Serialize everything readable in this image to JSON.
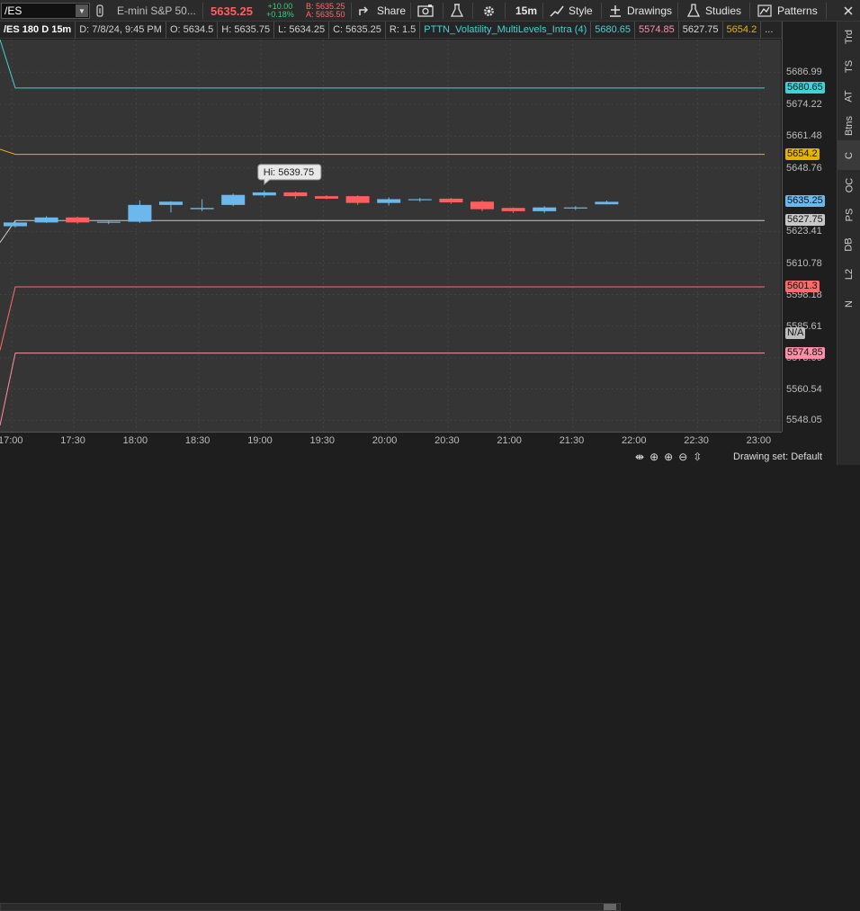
{
  "toolbar": {
    "symbol": "/ES",
    "description": "E-mini S&P 50...",
    "last_price": "5635.25",
    "change": "+10.00",
    "change_pct": "+0.18%",
    "bid": "B: 5635.25",
    "ask": "A: 5635.50",
    "share_label": "Share",
    "timeframe": "15m",
    "style_label": "Style",
    "drawings_label": "Drawings",
    "studies_label": "Studies",
    "patterns_label": "Patterns"
  },
  "infobar": {
    "title": "/ES 180 D 15m",
    "date": "D: 7/8/24, 9:45 PM",
    "open": "O: 5634.5",
    "high": "H: 5635.75",
    "low": "L: 5634.25",
    "close": "C: 5635.25",
    "range": "R: 1.5",
    "study": "PTTN_Volatility_MultiLevels_Intra (4)",
    "levels": [
      "5680.65",
      "5574.85",
      "5627.75",
      "5654.2"
    ],
    "more": "..."
  },
  "chart_data": {
    "type": "candlestick",
    "x_tick_labels": [
      "17:00",
      "17:30",
      "18:00",
      "18:30",
      "19:00",
      "19:30",
      "20:00",
      "20:30",
      "21:00",
      "21:30",
      "22:00",
      "22:30",
      "23:00"
    ],
    "y_tick_labels": [
      "5686.99",
      "5674.22",
      "5661.48",
      "5648.76",
      "5623.41",
      "5610.78",
      "5598.18",
      "5585.61",
      "5573.00",
      "5560.54",
      "5548.05"
    ],
    "ylim": [
      5543.5,
      5700.0
    ],
    "candles": [
      {
        "o": 5625.5,
        "h": 5627.5,
        "l": 5625.0,
        "c": 5627.0
      },
      {
        "o": 5627.0,
        "h": 5629.5,
        "l": 5626.8,
        "c": 5629.0
      },
      {
        "o": 5629.0,
        "h": 5629.3,
        "l": 5626.5,
        "c": 5627.0
      },
      {
        "o": 5627.0,
        "h": 5627.5,
        "l": 5626.3,
        "c": 5627.3
      },
      {
        "o": 5627.3,
        "h": 5635.8,
        "l": 5626.8,
        "c": 5634.0
      },
      {
        "o": 5634.0,
        "h": 5635.5,
        "l": 5631.0,
        "c": 5635.3
      },
      {
        "o": 5632.3,
        "h": 5636.3,
        "l": 5631.5,
        "c": 5632.8
      },
      {
        "o": 5634.0,
        "h": 5638.5,
        "l": 5633.5,
        "c": 5638.0
      },
      {
        "o": 5637.8,
        "h": 5639.75,
        "l": 5637.0,
        "c": 5639.0
      },
      {
        "o": 5639.0,
        "h": 5639.3,
        "l": 5636.5,
        "c": 5637.5
      },
      {
        "o": 5637.5,
        "h": 5637.8,
        "l": 5636.3,
        "c": 5636.5
      },
      {
        "o": 5637.5,
        "h": 5637.8,
        "l": 5634.0,
        "c": 5634.8
      },
      {
        "o": 5634.8,
        "h": 5637.0,
        "l": 5633.8,
        "c": 5636.3
      },
      {
        "o": 5636.0,
        "h": 5636.8,
        "l": 5635.3,
        "c": 5636.3
      },
      {
        "o": 5636.5,
        "h": 5636.8,
        "l": 5634.5,
        "c": 5635.0
      },
      {
        "o": 5635.3,
        "h": 5635.8,
        "l": 5631.5,
        "c": 5632.3
      },
      {
        "o": 5632.8,
        "h": 5633.0,
        "l": 5630.8,
        "c": 5631.5
      },
      {
        "o": 5631.5,
        "h": 5633.5,
        "l": 5630.8,
        "c": 5633.0
      },
      {
        "o": 5632.8,
        "h": 5633.5,
        "l": 5632.0,
        "c": 5633.0
      },
      {
        "o": 5634.25,
        "h": 5635.75,
        "l": 5634.25,
        "c": 5635.25
      }
    ],
    "levels": [
      {
        "value": 5680.65,
        "color": "#3fd3d8",
        "label": "5680.65",
        "start": 5700.0
      },
      {
        "value": 5654.2,
        "color": "#e6b400",
        "label": "5654.2",
        "start": 5656.2
      },
      {
        "value": 5627.75,
        "color": "#c8c8c8",
        "label": "5627.75",
        "start": 5619.0
      },
      {
        "value": 5601.3,
        "color": "#ff6a6a",
        "label": "5601.3",
        "start": 5576.0
      },
      {
        "value": 5574.85,
        "color": "#ff8fa6",
        "label": "5574.85",
        "start": 5546.0
      }
    ],
    "last_price_tag": "5635.25",
    "na_tag": "N/A",
    "high_bubble": "Hi: 5639.75"
  },
  "sidebar": [
    "Trd",
    "TS",
    "AT",
    "Btns",
    "C",
    "OC",
    "PS",
    "DB",
    "L2",
    "N"
  ],
  "bottom": {
    "drawing_set": "Drawing set: Default"
  },
  "colors": {
    "up": "#6cb8ec",
    "down": "#ff5e5e",
    "doji": "#dcdcdc",
    "plot_bg": "#353535"
  }
}
